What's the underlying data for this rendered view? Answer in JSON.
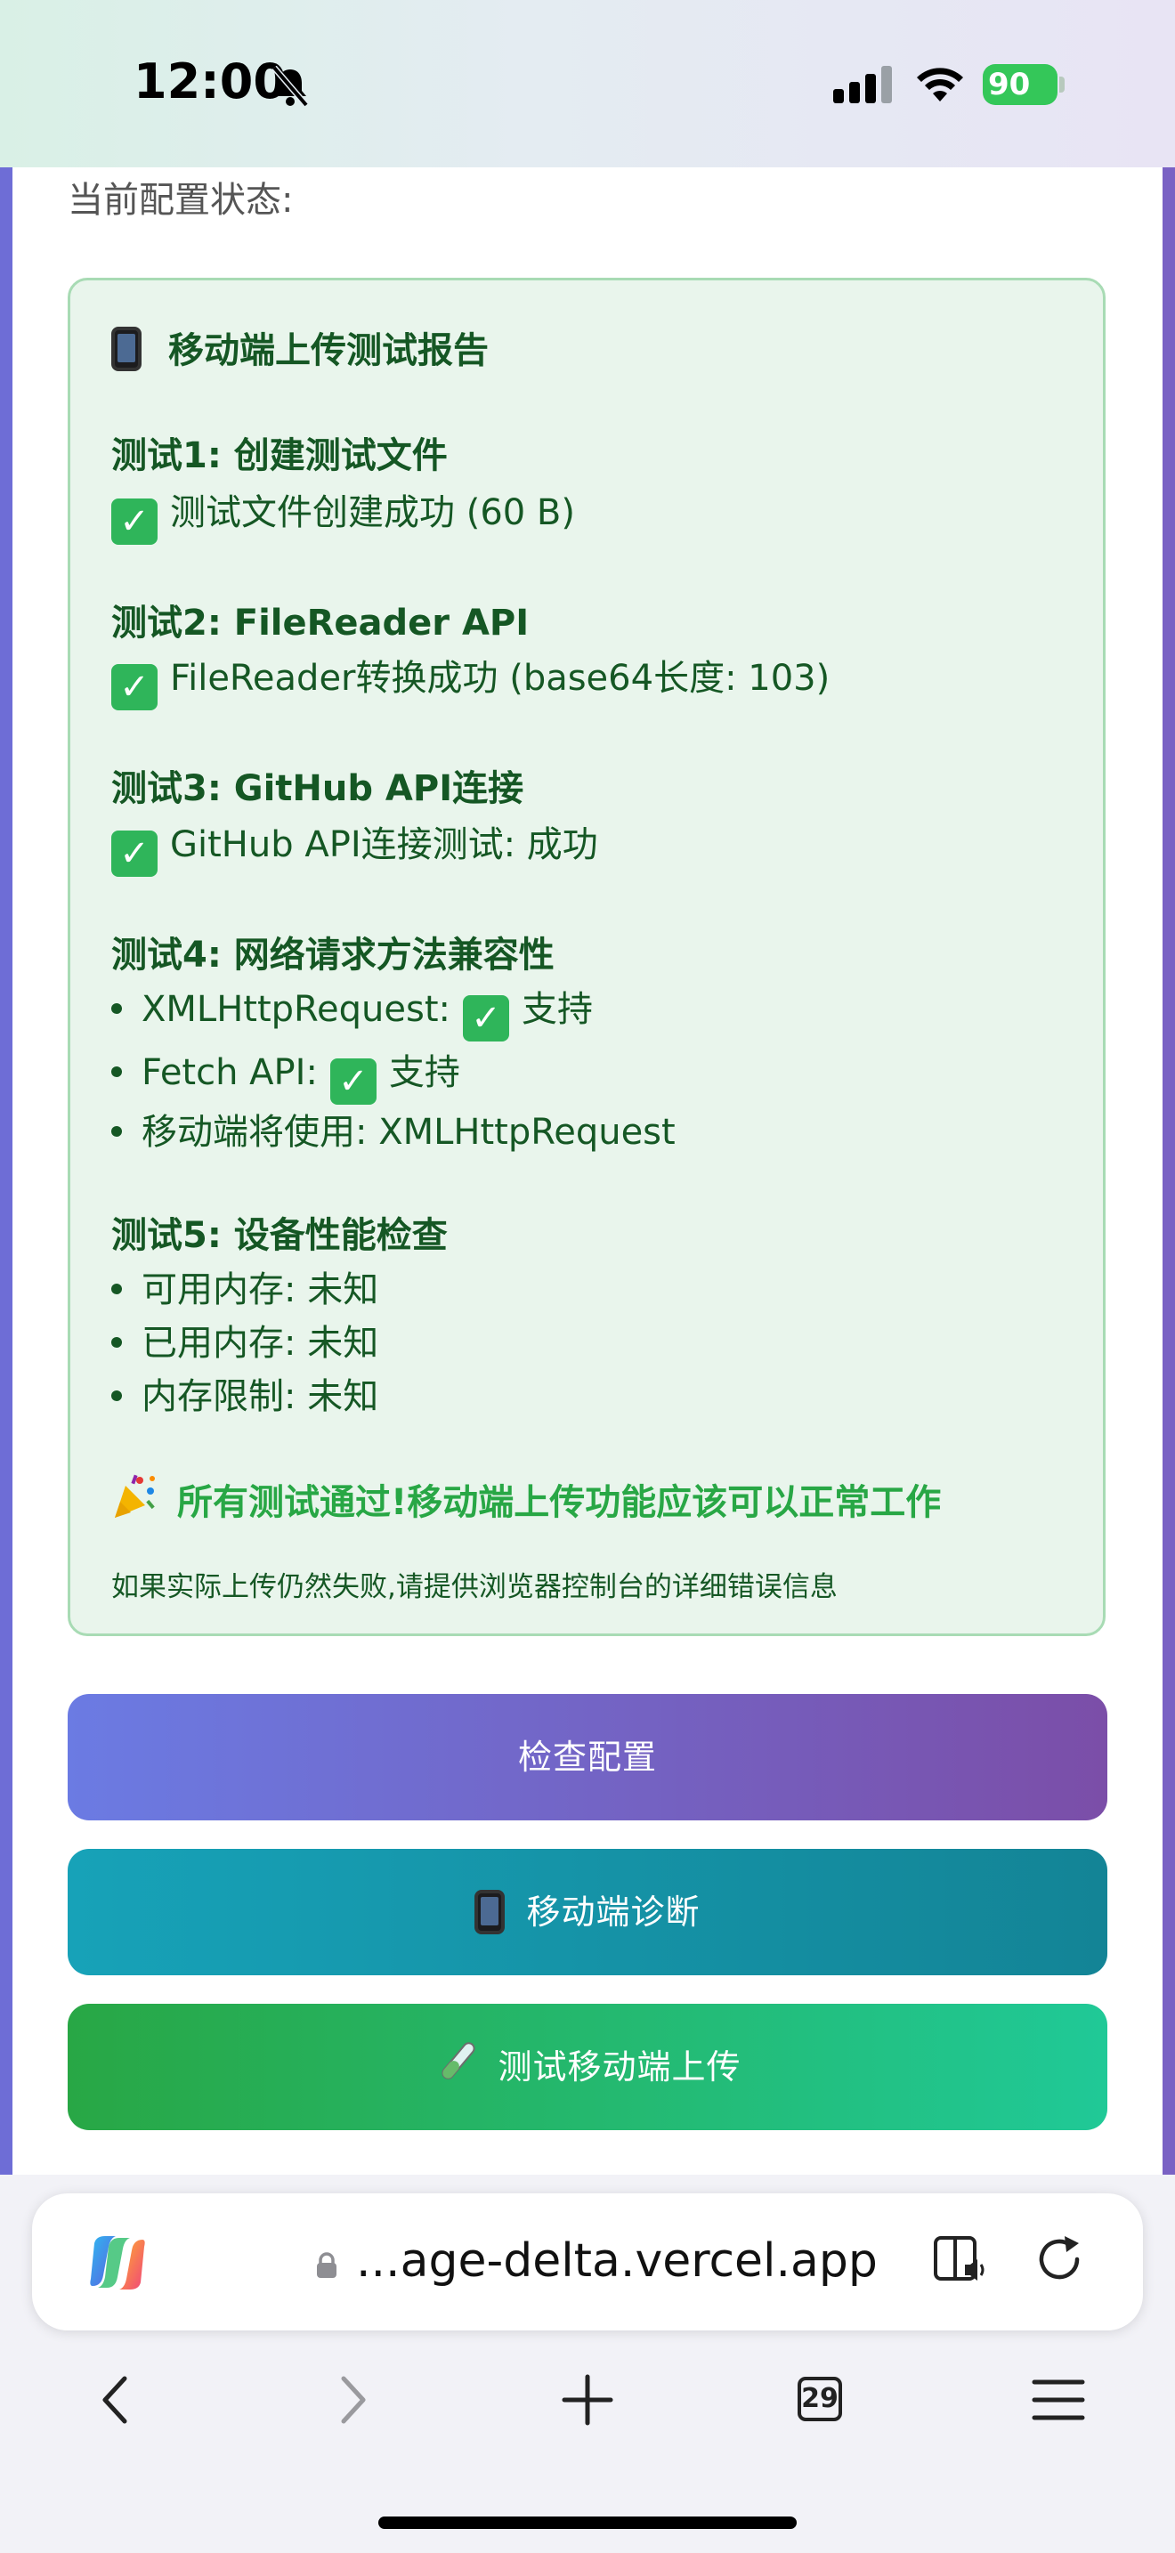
{
  "status_bar": {
    "time": "12:00",
    "battery": "90",
    "icons": [
      "bell-slash-icon",
      "cellular-signal-icon",
      "wifi-icon",
      "battery-charging-icon"
    ]
  },
  "page": {
    "config_status_label": "当前配置状态:"
  },
  "report": {
    "title": "移动端上传测试报告",
    "test1": {
      "heading": "测试1: 创建测试文件",
      "result": "测试文件创建成功 (60 B)"
    },
    "test2": {
      "heading": "测试2: FileReader API",
      "result": "FileReader转换成功 (base64长度: 103)"
    },
    "test3": {
      "heading": "测试3: GitHub API连接",
      "result": "GitHub API连接测试: 成功"
    },
    "test4": {
      "heading": "测试4: 网络请求方法兼容性",
      "xhr_label": "XMLHttpRequest:",
      "xhr_value": "支持",
      "fetch_label": "Fetch API:",
      "fetch_value": "支持",
      "mobile_method": "移动端将使用: XMLHttpRequest"
    },
    "test5": {
      "heading": "测试5: 设备性能检查",
      "available_memory": "可用内存: 未知",
      "used_memory": "已用内存: 未知",
      "memory_limit": "内存限制: 未知"
    },
    "success_message": "所有测试通过!移动端上传功能应该可以正常工作",
    "note": "如果实际上传仍然失败,请提供浏览器控制台的详细错误信息"
  },
  "buttons": {
    "check_config": "检查配置",
    "mobile_diagnose": "移动端诊断",
    "test_mobile_upload": "测试移动端上传"
  },
  "browser": {
    "url": "...age-delta.vercel.app",
    "tab_count": "29"
  },
  "colors": {
    "report_bg": "#e9f5ec",
    "report_border": "#a8dbb4",
    "report_text": "#155724",
    "success_text": "#28a745",
    "check_config_gradient": [
      "#6b7be3",
      "#7b4ea8"
    ],
    "diagnose_gradient": [
      "#17a2b8",
      "#138496"
    ],
    "test_upload_gradient": [
      "#28a745",
      "#20c997"
    ]
  }
}
